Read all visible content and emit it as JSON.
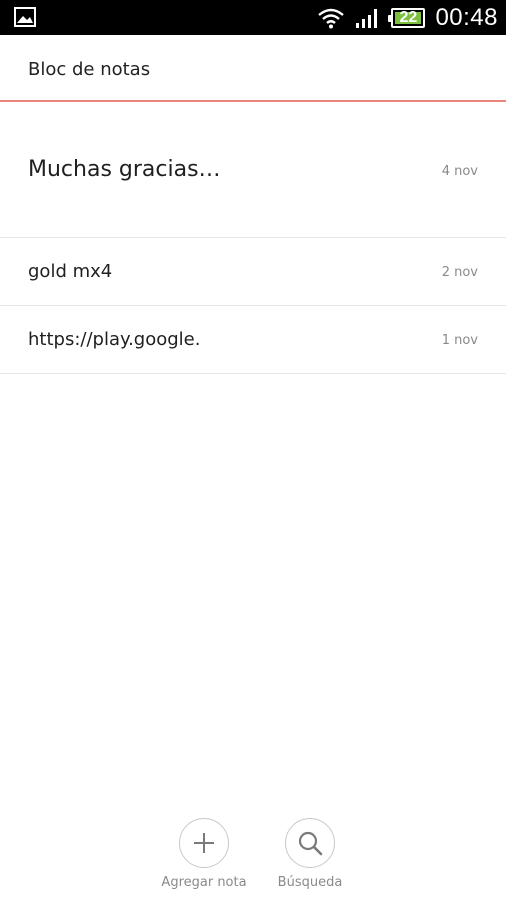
{
  "status_bar": {
    "battery_level": "22",
    "time": "00:48",
    "icons": [
      "gallery-icon",
      "wifi-icon",
      "signal-icon",
      "battery-icon"
    ]
  },
  "header": {
    "title": "Bloc de notas",
    "accent_color": "#e9857b"
  },
  "notes": [
    {
      "title": "Muchas gracias…",
      "date": "4 nov"
    },
    {
      "title": "gold mx4",
      "date": "2 nov"
    },
    {
      "title": "https://play.google.",
      "date": "1 nov"
    }
  ],
  "bottom_bar": {
    "add_label": "Agregar nota",
    "search_label": "Búsqueda",
    "icons": [
      "plus-icon",
      "search-icon"
    ]
  }
}
